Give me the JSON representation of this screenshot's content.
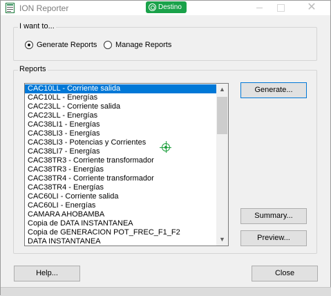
{
  "window": {
    "title": "ION Reporter",
    "badge": "Destino",
    "close_glyph": "✕"
  },
  "want_group": {
    "label": "I want to...",
    "options": [
      {
        "label": "Generate Reports",
        "checked": true
      },
      {
        "label": "Manage Reports",
        "checked": false
      }
    ]
  },
  "reports_group": {
    "label": "Reports",
    "items": [
      "CAC10LL - Corriente salida",
      "CAC10LL - Energías",
      "CAC23LL - Corriente salida",
      "CAC23LL - Energías",
      "CAC38LI1 - Energías",
      "CAC38LI3 - Energías",
      "CAC38LI3 - Potencias y Corrientes",
      "CAC38LI7 - Energías",
      "CAC38TR3 - Corriente transformador",
      "CAC38TR3 - Energías",
      "CAC38TR4 - Corriente transformador",
      "CAC38TR4 - Energías",
      "CAC60LI - Corriente salida",
      "CAC60LI - Energías",
      "CAMARA AHOBAMBA",
      "Copia de DATA INSTANTANEA",
      "Copia de GENERACION POT_FREC_F1_F2",
      "DATA INSTANTANEA"
    ],
    "selected_index": 0
  },
  "buttons": {
    "generate": "Generate...",
    "summary": "Summary...",
    "preview": "Preview...",
    "help": "Help...",
    "close": "Close"
  },
  "colors": {
    "selection": "#0078d7",
    "badge": "#1aa24a",
    "focus_border": "#0078d7"
  },
  "icons": {
    "app": "report-app-icon",
    "target": "crosshair-target-icon"
  }
}
